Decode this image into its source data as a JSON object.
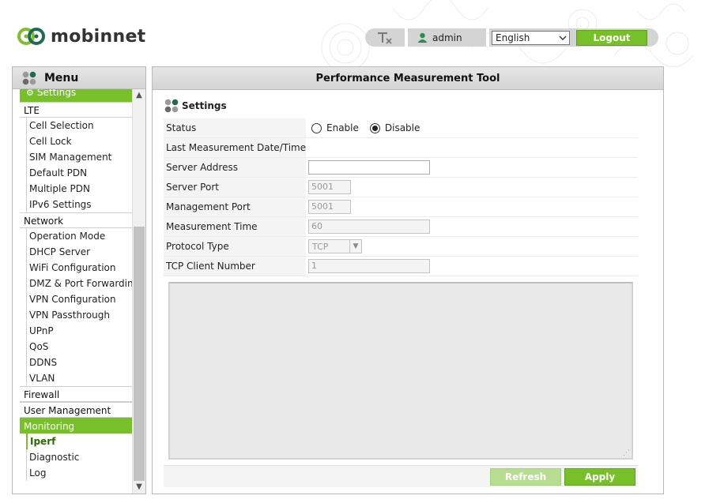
{
  "header": {
    "brand": "mobinnet",
    "user": "admin",
    "language": "English",
    "logout_label": "Logout"
  },
  "sidebar": {
    "title": "Menu",
    "settings_label": "Settings",
    "groups": [
      {
        "label": "LTE",
        "items": [
          "Cell Selection",
          "Cell Lock",
          "SIM Management",
          "Default PDN",
          "Multiple PDN",
          "IPv6 Settings"
        ]
      },
      {
        "label": "Network",
        "items": [
          "Operation Mode",
          "DHCP Server",
          "WiFi Configuration",
          "DMZ & Port Forwarding",
          "VPN Configuration",
          "VPN Passthrough",
          "UPnP",
          "QoS",
          "DDNS",
          "VLAN"
        ]
      },
      {
        "label": "Firewall",
        "items": []
      },
      {
        "label": "User Management",
        "items": []
      },
      {
        "label": "Monitoring",
        "items": [
          "Iperf",
          "Diagnostic",
          "Log"
        ]
      }
    ],
    "active_item": "Iperf"
  },
  "main": {
    "title": "Performance Measurement Tool",
    "section_title": "Settings",
    "fields": {
      "status": {
        "label": "Status",
        "options": [
          "Enable",
          "Disable"
        ],
        "selected": "Disable"
      },
      "last_measurement": {
        "label": "Last Measurement Date/Time",
        "value": ""
      },
      "server_address": {
        "label": "Server Address",
        "value": ""
      },
      "server_port": {
        "label": "Server Port",
        "value": "5001"
      },
      "management_port": {
        "label": "Management Port",
        "value": "5001"
      },
      "measurement_time": {
        "label": "Measurement Time",
        "value": "60"
      },
      "protocol_type": {
        "label": "Protocol Type",
        "value": "TCP"
      },
      "tcp_client_number": {
        "label": "TCP Client Number",
        "value": "1"
      }
    },
    "refresh_label": "Refresh",
    "apply_label": "Apply"
  },
  "colors": {
    "accent": "#78c02a",
    "accent_dark": "#5fa01c",
    "brand_dark_green": "#1f6a55"
  }
}
